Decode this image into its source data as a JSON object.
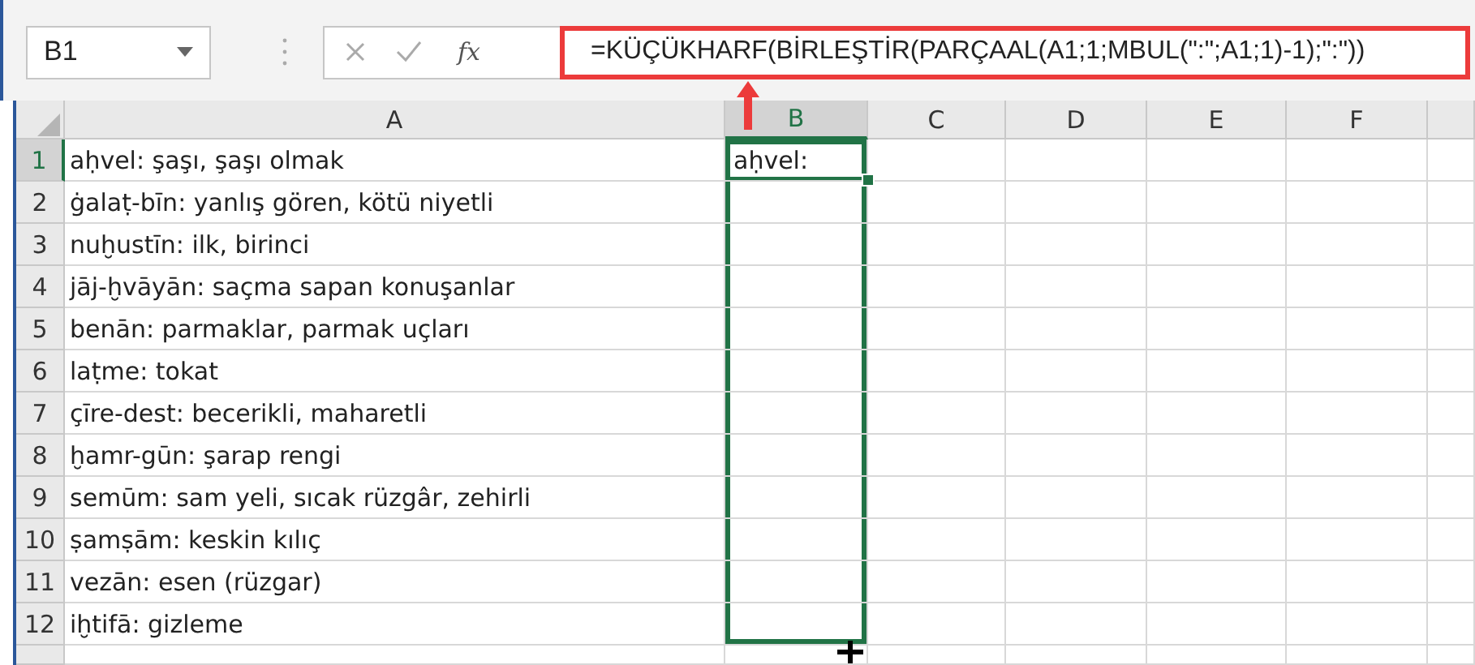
{
  "name_box": "B1",
  "function_button": "fx",
  "formula": "=KÜÇÜKHARF(BİRLEŞTİR(PARÇAAL(A1;1;MBUL(\":\";A1;1)-1);\":\"))",
  "formula_highlighted": true,
  "columns": [
    {
      "label": "A",
      "selected": false
    },
    {
      "label": "B",
      "selected": true
    },
    {
      "label": "C",
      "selected": false
    },
    {
      "label": "D",
      "selected": false
    },
    {
      "label": "E",
      "selected": false
    },
    {
      "label": "F",
      "selected": false
    }
  ],
  "rows": [
    {
      "number": "1",
      "selected": true,
      "in_range": true,
      "cells": [
        "aḥvel: şaşı, şaşı olmak",
        "aḥvel:"
      ]
    },
    {
      "number": "2",
      "selected": false,
      "in_range": true,
      "cells": [
        "ġalaṭ-bīn: yanlış gören, kötü niyetli"
      ]
    },
    {
      "number": "3",
      "selected": false,
      "in_range": true,
      "cells": [
        "nuḫustīn: ilk, birinci"
      ]
    },
    {
      "number": "4",
      "selected": false,
      "in_range": true,
      "cells": [
        "jāj-ḫvāyān: saçma sapan konuşanlar"
      ]
    },
    {
      "number": "5",
      "selected": false,
      "in_range": true,
      "cells": [
        "benān: parmaklar, parmak uçları"
      ]
    },
    {
      "number": "6",
      "selected": false,
      "in_range": true,
      "cells": [
        "laṭme: tokat"
      ]
    },
    {
      "number": "7",
      "selected": false,
      "in_range": true,
      "cells": [
        "çīre-dest: becerikli, maharetli"
      ]
    },
    {
      "number": "8",
      "selected": false,
      "in_range": true,
      "cells": [
        "ḫamr-gūn: şarap rengi"
      ]
    },
    {
      "number": "9",
      "selected": false,
      "in_range": true,
      "cells": [
        "semūm: sam yeli, sıcak rüzgâr, zehirli"
      ]
    },
    {
      "number": "10",
      "selected": false,
      "in_range": true,
      "cells": [
        "ṣamṣām: keskin kılıç"
      ]
    },
    {
      "number": "11",
      "selected": false,
      "in_range": true,
      "cells": [
        "vezān: esen (rüzgar)"
      ]
    },
    {
      "number": "12",
      "selected": false,
      "in_range": true,
      "cells": [
        "iḫtifā: gizleme"
      ]
    }
  ]
}
